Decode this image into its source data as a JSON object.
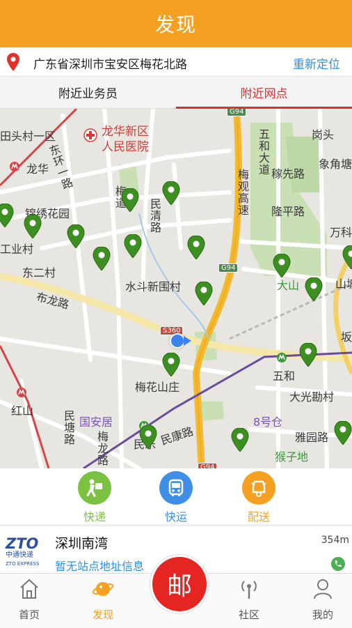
{
  "header": {
    "title": "发现"
  },
  "location": {
    "address": "广东省深圳市宝安区梅花北路",
    "relocate_label": "重新定位"
  },
  "tabs": [
    {
      "label": "附近业务员",
      "active": false
    },
    {
      "label": "附近网点",
      "active": true
    }
  ],
  "map": {
    "labels": {
      "hospital1": "龙华新区",
      "hospital2": "人民医院",
      "jinxiu": "锦绣花园",
      "longhua": "龙华",
      "gongye": "工业村",
      "dongercun": "东二村",
      "bulonglu": "布龙路",
      "shuidou": "水斗新围村",
      "meihua": "梅花山庄",
      "guoanju": "国安居",
      "hongshan": "红山",
      "wuhe": "五和",
      "daguang": "大光勘村",
      "yayuan": "雅园路",
      "houzi": "猴子地",
      "bahaocang": "8号仓",
      "dashan": "大山",
      "longping": "隆平路",
      "jiaxian": "稼先路",
      "wuhedadao": "五和大道",
      "gangtou": "岗头",
      "xiangjiao": "象角塘",
      "wanke": "万科",
      "shantang": "山塘",
      "ban": "坂",
      "meiguan": "梅观高速",
      "dongyuan": "东环一路",
      "mingqing": "民清路",
      "minkang": "民康路",
      "mintang": "民塘路",
      "meilonglu": "梅龙路",
      "meilu": "梅道",
      "tou": "田头村一区",
      "minle": "民乐"
    },
    "roadsigns": {
      "g94_top": "G94",
      "g94_mid": "G94",
      "s360": "S360",
      "g94_bottom": "G94"
    }
  },
  "services": [
    {
      "label": "快递",
      "color": "#7cc242",
      "icon": "courier-icon"
    },
    {
      "label": "快运",
      "color": "#3f8fe6",
      "icon": "bus-icon"
    },
    {
      "label": "配送",
      "color": "#f6a021",
      "icon": "scooter-icon"
    }
  ],
  "station": {
    "logo_main": "ZTO",
    "logo_sub": "中通快递",
    "logo_en": "ZTO EXPRESS",
    "name": "深圳南湾",
    "distance": "354m",
    "address": "暂无站点地址信息"
  },
  "tabbar": {
    "home": "首页",
    "discover": "发现",
    "post": "邮",
    "community": "社区",
    "mine": "我的"
  },
  "colors": {
    "accent": "#f6a021",
    "active_tab": "#e52c2c",
    "link": "#2f8ee0",
    "marker": "#3d8f22"
  }
}
